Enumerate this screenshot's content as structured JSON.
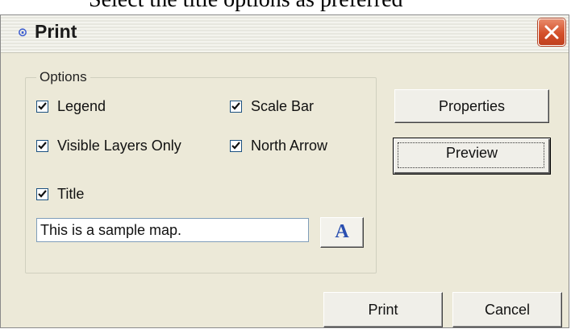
{
  "caption": {
    "text": "Select the title options as preferred"
  },
  "window": {
    "title": "Print",
    "icon": "print-dialog-icon",
    "close_icon": "close-icon"
  },
  "options": {
    "group_label": "Options",
    "checkboxes": {
      "legend": {
        "label": "Legend",
        "checked": true
      },
      "scale_bar": {
        "label": "Scale Bar",
        "checked": true
      },
      "visible_layers_only": {
        "label": "Visible Layers Only",
        "checked": true
      },
      "north_arrow": {
        "label": "North Arrow",
        "checked": true
      },
      "title": {
        "label": "Title",
        "checked": true
      }
    },
    "title_field_value": "This is a sample map.",
    "font_button_label": "A"
  },
  "buttons": {
    "properties": "Properties",
    "preview": "Preview",
    "print": "Print",
    "cancel": "Cancel"
  },
  "colors": {
    "dialog_bg": "#ece9d8",
    "close_button": "#d4502b",
    "font_glyph": "#2a4fb0"
  }
}
